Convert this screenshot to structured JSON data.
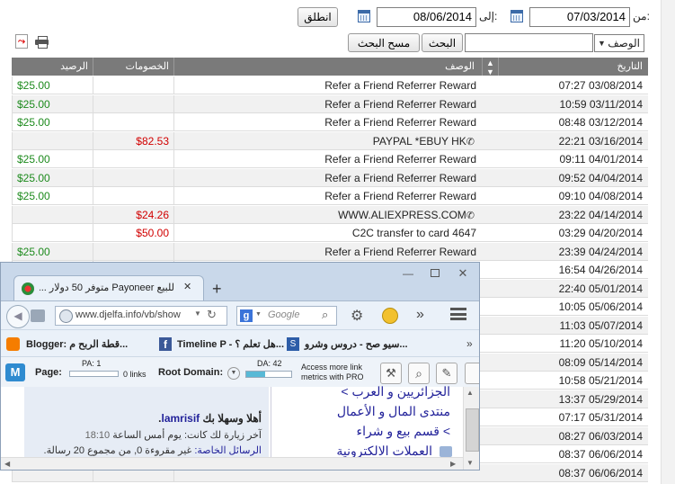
{
  "filter": {
    "from_label": "من:",
    "from_date": "07/03/2014",
    "to_label": "إلى:",
    "to_date": "08/06/2014",
    "go_button": "انطلق",
    "description_select": "الوصف",
    "search_button": "البحث",
    "clear_search_button": "مسح البحث",
    "search_value": ""
  },
  "table": {
    "headers": {
      "date": "التاريخ",
      "description": "الوصف",
      "deductions": "الخصومات",
      "balance": "الرصيد"
    },
    "rows": [
      {
        "date": "07:27 03/08/2014",
        "description": "Refer a Friend Referrer Reward",
        "deduction": "",
        "balance": "$25.00",
        "phone": false
      },
      {
        "date": "10:59 03/11/2014",
        "description": "Refer a Friend Referrer Reward",
        "deduction": "",
        "balance": "$25.00",
        "phone": false
      },
      {
        "date": "08:48 03/12/2014",
        "description": "Refer a Friend Referrer Reward",
        "deduction": "",
        "balance": "$25.00",
        "phone": false
      },
      {
        "date": "22:21 03/16/2014",
        "description": "PAYPAL *EBUY HK",
        "deduction": "$82.53",
        "balance": "",
        "phone": true
      },
      {
        "date": "09:11 04/01/2014",
        "description": "Refer a Friend Referrer Reward",
        "deduction": "",
        "balance": "$25.00",
        "phone": false
      },
      {
        "date": "09:52 04/04/2014",
        "description": "Refer a Friend Referrer Reward",
        "deduction": "",
        "balance": "$25.00",
        "phone": false
      },
      {
        "date": "09:10 04/08/2014",
        "description": "Refer a Friend Referrer Reward",
        "deduction": "",
        "balance": "$25.00",
        "phone": false
      },
      {
        "date": "23:22 04/14/2014",
        "description": "WWW.ALIEXPRESS.COM",
        "deduction": "$24.26",
        "balance": "",
        "phone": true
      },
      {
        "date": "03:29 04/20/2014",
        "description": "C2C transfer to card 4647",
        "deduction": "$50.00",
        "balance": "",
        "phone": false
      },
      {
        "date": "23:39 04/24/2014",
        "description": "Refer a Friend Referrer Reward",
        "deduction": "",
        "balance": "$25.00",
        "phone": false
      },
      {
        "date": "16:54 04/26/2014",
        "description": "",
        "deduction": "",
        "balance": "",
        "phone": false
      },
      {
        "date": "22:40 05/01/2014",
        "description": "",
        "deduction": "",
        "balance": "",
        "phone": false
      },
      {
        "date": "10:05 05/06/2014",
        "description": "",
        "deduction": "",
        "balance": "",
        "phone": false
      },
      {
        "date": "11:03 05/07/2014",
        "description": "",
        "deduction": "",
        "balance": "",
        "phone": false
      },
      {
        "date": "11:20 05/10/2014",
        "description": "",
        "deduction": "",
        "balance": "",
        "phone": false
      },
      {
        "date": "08:09 05/14/2014",
        "description": "",
        "deduction": "",
        "balance": "",
        "phone": false
      },
      {
        "date": "10:58 05/21/2014",
        "description": "",
        "deduction": "",
        "balance": "",
        "phone": false
      },
      {
        "date": "13:37 05/29/2014",
        "description": "",
        "deduction": "",
        "balance": "",
        "phone": false
      },
      {
        "date": "07:17 05/31/2014",
        "description": "",
        "deduction": "",
        "balance": "",
        "phone": false
      },
      {
        "date": "08:27 06/03/2014",
        "description": "",
        "deduction": "",
        "balance": "",
        "phone": false
      },
      {
        "date": "08:37 06/06/2014",
        "description": "",
        "deduction": "",
        "balance": "",
        "phone": false
      },
      {
        "date": "08:37 06/06/2014",
        "description": "",
        "deduction": "",
        "balance": "",
        "phone": false
      }
    ]
  },
  "browser": {
    "tab_title": "للبيع Payoneer متوفر 50 دولار ...",
    "new_tab": "+",
    "url": "www.djelfa.info/vb/show",
    "search_placeholder": "Google",
    "bookmarks": [
      "Blogger: قطة الربح م...",
      "Timeline P - هل تعلم ؟...",
      "سيو صح - دروس وشرو..."
    ],
    "moz": {
      "page_label": "Page:",
      "pa_label": "PA: 1",
      "links_label": "0 links",
      "root_domain_label": "Root Domain:",
      "da_label": "DA: 42",
      "pro_text_1": "Access more link",
      "pro_text_2": "metrics with PRO"
    },
    "content": {
      "breadcrumb_1": "الجزائريين و العرب >",
      "breadcrumb_2": "منتدى المال و الأعمال",
      "breadcrumb_3": "> قسم بيع و شراء",
      "breadcrumb_4": "العملات الالكترونية",
      "welcome_prefix": "أهلا وسهلا بك",
      "username": "lamrisif",
      "last_visit_label": "آخر زيارة لك كانت:",
      "last_visit_value": "يوم أمس الساعة",
      "last_visit_time": "18:10",
      "messages_label": "الرسائل الخاصة:",
      "messages_value": "غير مقروءة 0, من مجموع 20 رسالة."
    }
  },
  "colors": {
    "positive": "#1e8b1e",
    "negative": "#d10000",
    "header_bg": "#7a7a7a"
  }
}
